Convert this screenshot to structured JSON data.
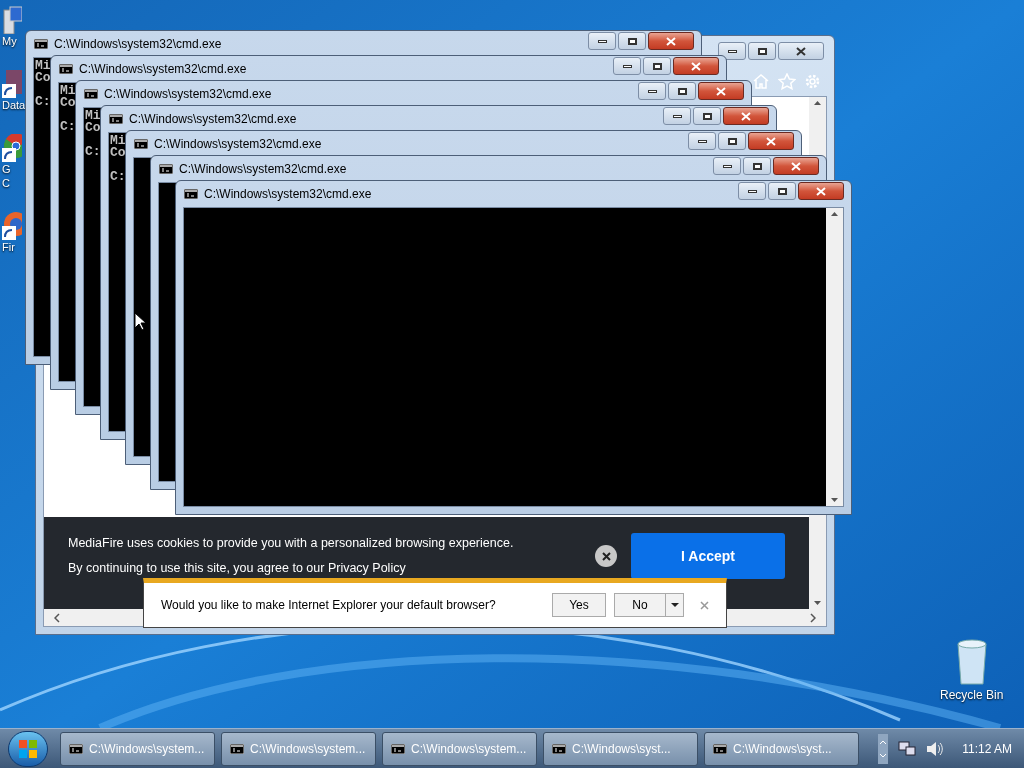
{
  "desktop_icons": [
    {
      "kind": "computer",
      "lines": [
        "My"
      ]
    },
    {
      "kind": "shortcut",
      "lines": [
        "Data"
      ]
    },
    {
      "kind": "chrome",
      "lines": [
        "G",
        "C"
      ]
    },
    {
      "kind": "firefox",
      "lines": [
        "Fir"
      ]
    }
  ],
  "recycle_bin": {
    "label": "Recycle Bin"
  },
  "browser": {
    "cookie_banner": {
      "lines": [
        "MediaFire uses cookies to provide you with a personalized browsing experience.",
        "By continuing to use this site, you agree to our Privacy Policy"
      ],
      "accept": "I Accept"
    },
    "notification": {
      "text": "Would you like to make Internet Explorer your default browser?",
      "yes": "Yes",
      "no": "No"
    }
  },
  "cmd_windows": [
    {
      "title": "C:\\Windows\\system32\\cmd.exe",
      "banner": [
        "Mi",
        "Co"
      ],
      "prompt": "C:"
    },
    {
      "title": "C:\\Windows\\system32\\cmd.exe",
      "banner": [
        "Mi",
        "Co"
      ],
      "prompt": "C:"
    },
    {
      "title": "C:\\Windows\\system32\\cmd.exe",
      "banner": [
        "Mi",
        "Co"
      ],
      "prompt": "C:"
    },
    {
      "title": "C:\\Windows\\system32\\cmd.exe",
      "banner": [
        "Mi",
        "Co"
      ],
      "prompt": "C:"
    },
    {
      "title": "C:\\Windows\\system32\\cmd.exe"
    },
    {
      "title": "C:\\Windows\\system32\\cmd.exe"
    },
    {
      "title": "C:\\Windows\\system32\\cmd.exe"
    }
  ],
  "taskbar": {
    "buttons": [
      {
        "label": "C:\\Windows\\system..."
      },
      {
        "label": "C:\\Windows\\system..."
      },
      {
        "label": "C:\\Windows\\system..."
      },
      {
        "label": "C:\\Windows\\syst..."
      },
      {
        "label": "C:\\Windows\\syst..."
      }
    ],
    "clock": "11:12 AM"
  }
}
